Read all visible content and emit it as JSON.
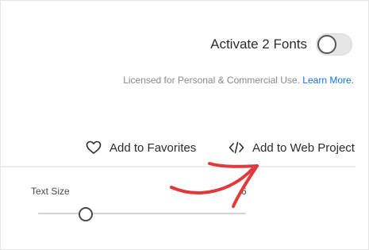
{
  "activate": {
    "label": "Activate 2 Fonts",
    "toggle_on": false
  },
  "license": {
    "text": "Licensed for Personal & Commercial Use.",
    "link": "Learn More."
  },
  "actions": {
    "favorites": {
      "label": "Add to Favorites",
      "icon": "heart-icon"
    },
    "web_project": {
      "label": "Add to Web Project",
      "icon": "code-icon"
    }
  },
  "text_size": {
    "label": "Text Size",
    "value_visible": "6"
  },
  "annotation": {
    "type": "red hand-drawn arrow",
    "color": "#e03a3a"
  },
  "colors": {
    "link": "#1473e6",
    "text": "#2c2c2c",
    "muted": "#8a8a8a",
    "divider": "#ececec"
  }
}
